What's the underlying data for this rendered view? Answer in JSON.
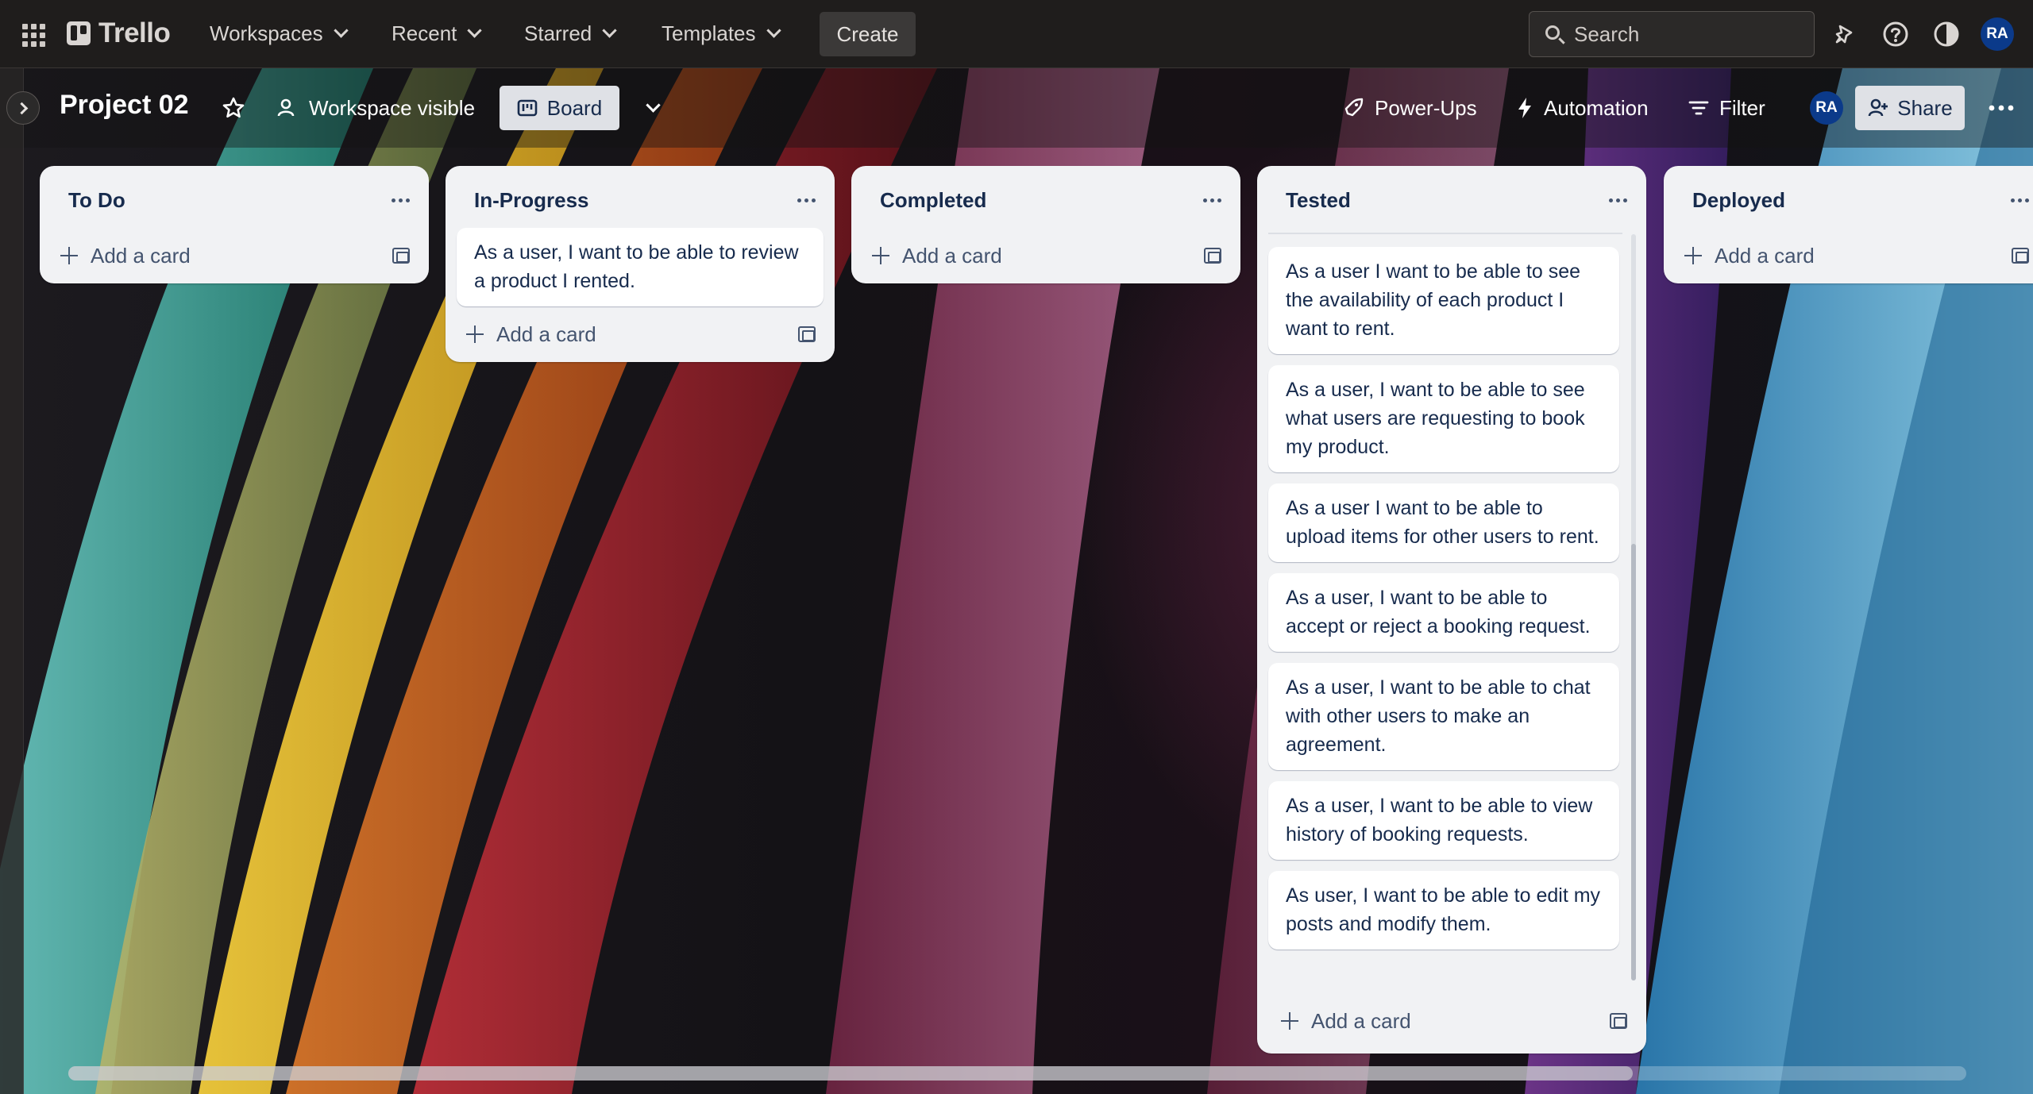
{
  "topnav": {
    "logo_text": "Trello",
    "menus": [
      {
        "label": "Workspaces"
      },
      {
        "label": "Recent"
      },
      {
        "label": "Starred"
      },
      {
        "label": "Templates"
      }
    ],
    "create_label": "Create",
    "search_placeholder": "Search",
    "avatar_initials": "RA",
    "icons": [
      "app-switcher-icon",
      "notifications-icon",
      "help-icon",
      "theme-icon"
    ]
  },
  "board": {
    "title": "Project 02",
    "visibility_label": "Workspace visible",
    "view_label": "Board",
    "powerups_label": "Power-Ups",
    "automation_label": "Automation",
    "filter_label": "Filter",
    "member_initials": "RA",
    "share_label": "Share"
  },
  "lists": [
    {
      "title": "To Do",
      "cards": [],
      "add_label": "Add a card"
    },
    {
      "title": "In-Progress",
      "cards": [
        "As a user, I want to be able to review a product I rented."
      ],
      "add_label": "Add a card"
    },
    {
      "title": "Completed",
      "cards": [],
      "add_label": "Add a card"
    },
    {
      "title": "Tested",
      "cards": [
        "As a user I want to be able to see the availability of each product I want to rent.",
        "As a user, I want to be able to see what users are requesting to book my product.",
        "As a user I want to be able to upload items for other users to rent.",
        "As a user, I want to be able to accept or reject a booking request.",
        "As a user, I want to be able to chat with other users to make an agreement.",
        "As a user, I want to be able to view history of booking requests.",
        "As user, I want to be able to edit my posts and modify them."
      ],
      "add_label": "Add a card"
    },
    {
      "title": "Deployed",
      "cards": [],
      "add_label": "Add a card"
    }
  ],
  "colors": {
    "nav_bg": "#1f1d1c",
    "list_bg": "#f1f2f4",
    "avatar_bg": "#0b3a8a"
  }
}
